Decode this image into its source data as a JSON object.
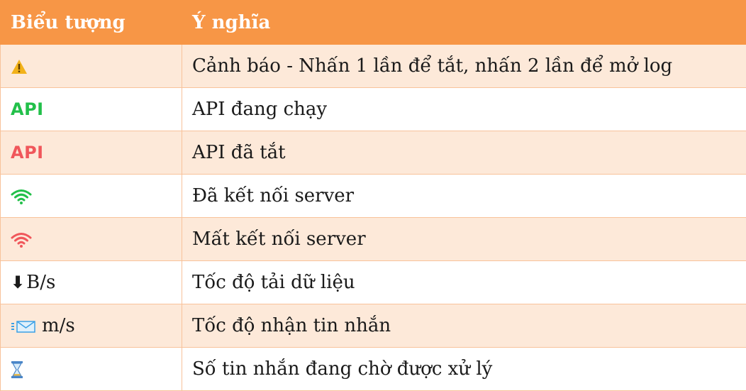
{
  "table": {
    "headers": [
      "Biểu tượng",
      "Ý nghĩa"
    ],
    "rows": [
      {
        "icon": "warning-icon",
        "icon_text": "",
        "meaning": "Cảnh báo - Nhấn 1 lần để tắt, nhấn 2 lần để mở log"
      },
      {
        "icon": "api-running-icon",
        "icon_text": "API",
        "icon_color": "#22c04a",
        "meaning": "API đang chạy"
      },
      {
        "icon": "api-stopped-icon",
        "icon_text": "API",
        "icon_color": "#f0575b",
        "meaning": "API đã tắt"
      },
      {
        "icon": "wifi-connected-icon",
        "icon_text": "",
        "icon_color": "#22c04a",
        "meaning": "Đã kết nối server"
      },
      {
        "icon": "wifi-disconnected-icon",
        "icon_text": "",
        "icon_color": "#f0575b",
        "meaning": "Mất kết nối server"
      },
      {
        "icon": "download-arrow-icon",
        "icon_text": "B/s",
        "meaning": "Tốc độ tải dữ liệu"
      },
      {
        "icon": "mail-icon",
        "icon_text": "m/s",
        "meaning": "Tốc độ nhận tin nhắn"
      },
      {
        "icon": "hourglass-icon",
        "icon_text": "",
        "meaning": "Số tin nhắn đang chờ được xử lý"
      }
    ]
  },
  "colors": {
    "header_bg": "#f79646",
    "row_alt_bg": "#fde9d9",
    "border": "#f8c29a",
    "green": "#22c04a",
    "red": "#f0575b"
  }
}
